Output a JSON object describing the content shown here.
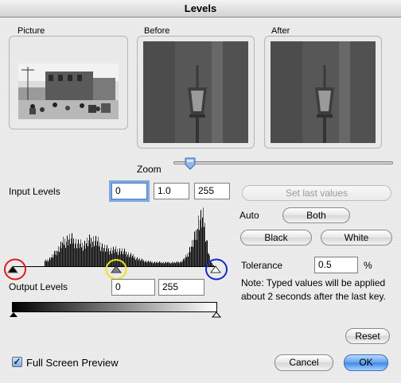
{
  "window": {
    "title": "Levels"
  },
  "previews": {
    "picture_label": "Picture",
    "before_label": "Before",
    "after_label": "After"
  },
  "zoom": {
    "label": "Zoom",
    "level": 0.05
  },
  "input_levels": {
    "label": "Input Levels",
    "black": "0",
    "gamma": "1.0",
    "white": "255"
  },
  "buttons": {
    "set_last_values": "Set last values",
    "auto_label": "Auto",
    "both": "Both",
    "black": "Black",
    "white": "White",
    "reset": "Reset",
    "cancel": "Cancel",
    "ok": "OK"
  },
  "tolerance": {
    "label": "Tolerance",
    "value": "0.5",
    "unit": "%"
  },
  "note": "Note: Typed values will be applied about 2 seconds after the last key.",
  "output_levels": {
    "label": "Output Levels",
    "black": "0",
    "white": "255"
  },
  "full_screen_preview": {
    "label": "Full Screen Preview",
    "checked": true
  },
  "colors": {
    "black_marker": "#e0181b",
    "gray_marker": "#f0e21a",
    "white_marker": "#1525c8",
    "default_button": "#3f86e4"
  }
}
